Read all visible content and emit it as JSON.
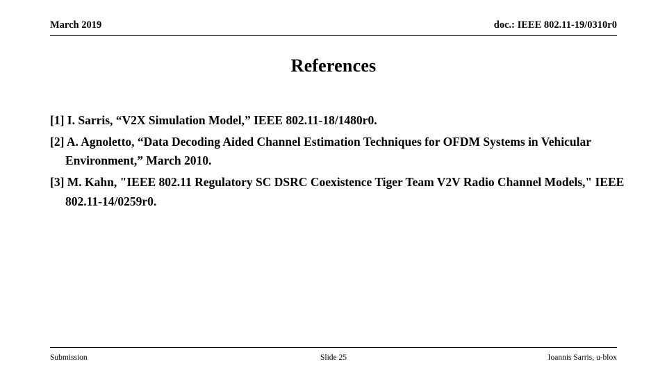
{
  "header": {
    "left": "March 2019",
    "right": "doc.: IEEE 802.11-19/0310r0"
  },
  "title": "References",
  "references": [
    {
      "line1": "[1] I. Sarris, “V2X Simulation Model,” IEEE 802.11-18/1480r0.",
      "line2": ""
    },
    {
      "line1": "[2] A. Agnoletto, “Data Decoding Aided Channel Estimation Techniques for OFDM Systems",
      "line2": "in Vehicular Environment,” March 2010."
    },
    {
      "line1": "[3] M. Kahn, \"IEEE 802.11 Regulatory SC DSRC Coexistence Tiger Team V2V Radio",
      "line2": "Channel Models,\" IEEE 802.11-14/0259r0."
    }
  ],
  "footer": {
    "left": "Submission",
    "center": "Slide 25",
    "right": "Ioannis Sarris, u-blox"
  }
}
